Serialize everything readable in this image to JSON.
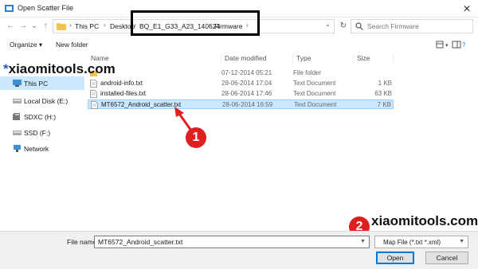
{
  "window": {
    "title": "Open Scatter File",
    "close_glyph": "✕"
  },
  "nav_buttons": {
    "back": "←",
    "forward": "→",
    "history": "⌄",
    "up": "↑"
  },
  "address": {
    "crumbs": [
      "This PC",
      "Desktop",
      "BQ_E1_G33_A23_140624",
      "Firmware"
    ],
    "separator": "›",
    "dropdown": "⌄",
    "refresh": "↻"
  },
  "search": {
    "placeholder": "Search Firmware"
  },
  "toolbar": {
    "organize_label": "Organize ▾",
    "new_folder_label": "New folder"
  },
  "nav_pane": {
    "items": [
      {
        "label": "This PC",
        "icon": "computer-icon",
        "selected": true
      },
      {
        "label": "Local Disk (E:)",
        "icon": "drive-icon",
        "selected": false
      },
      {
        "label": "SDXC (H:)",
        "icon": "sd-card-icon",
        "selected": false
      },
      {
        "label": "SSD (F:)",
        "icon": "drive-icon",
        "selected": false
      },
      {
        "label": "Network",
        "icon": "network-icon",
        "selected": false
      }
    ]
  },
  "watermarks": {
    "top_left": "xiaomitools.com",
    "bottom_right": "xiaomitools.com"
  },
  "file_list": {
    "columns": [
      "Name",
      "Date modified",
      "Type",
      "Size"
    ],
    "rows": [
      {
        "name": "",
        "date": "07-12-2014 05:21",
        "type": "File folder",
        "size": "",
        "icon": "folder-icon",
        "selected": false
      },
      {
        "name": "android-info.txt",
        "date": "28-06-2014 17:04",
        "type": "Text Document",
        "size": "1 KB",
        "icon": "text-file-icon",
        "selected": false
      },
      {
        "name": "installed-files.txt",
        "date": "28-06-2014 17:46",
        "type": "Text Document",
        "size": "63 KB",
        "icon": "text-file-icon",
        "selected": false
      },
      {
        "name": "MT6572_Android_scatter.txt",
        "date": "28-06-2014 16:59",
        "type": "Text Document",
        "size": "7 KB",
        "icon": "text-file-icon",
        "selected": true
      }
    ]
  },
  "annotations": {
    "step1": "1",
    "step2": "2"
  },
  "bottom": {
    "file_name_label": "File name:",
    "file_name_value": "MT6572_Android_scatter.txt",
    "file_type_value": "Map File (*.txt *.xml)",
    "open_label": "Open",
    "cancel_label": "Cancel"
  },
  "colors": {
    "accent": "#0078d7",
    "selection": "#cce8ff",
    "annotation": "#e02020"
  }
}
